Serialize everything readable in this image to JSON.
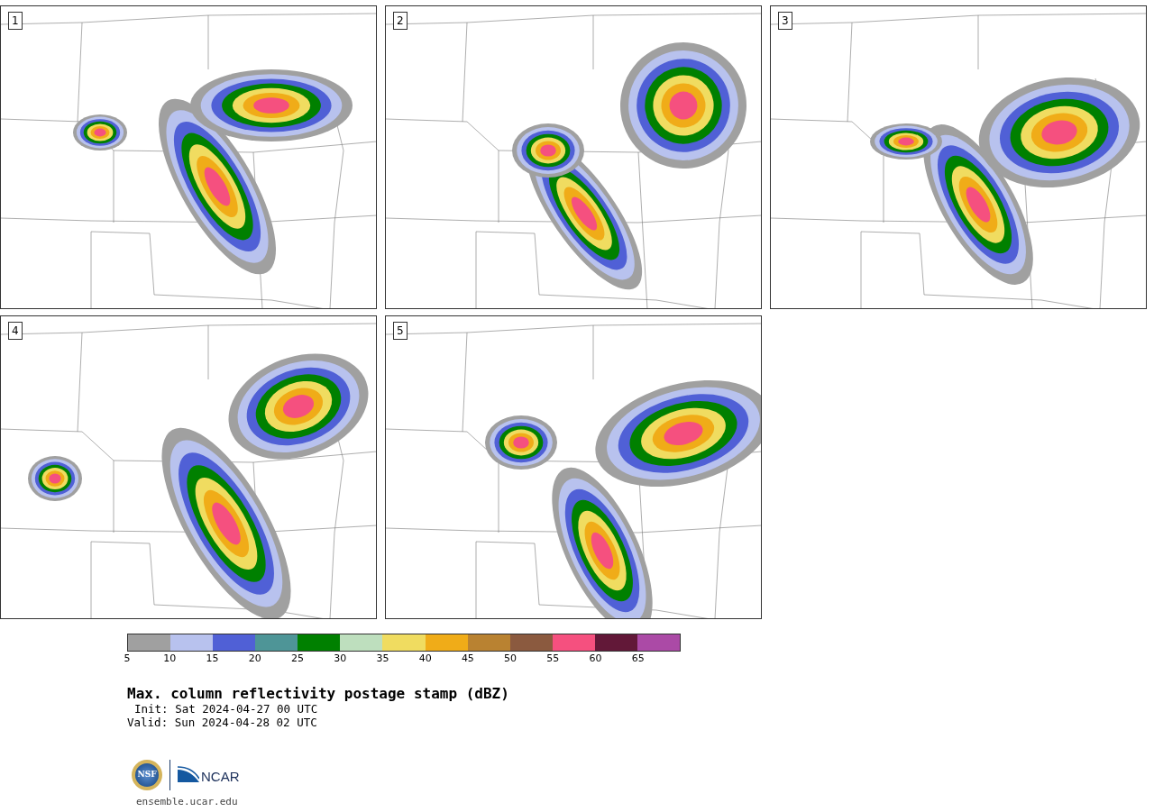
{
  "panels": [
    {
      "number": "1"
    },
    {
      "number": "2"
    },
    {
      "number": "3"
    },
    {
      "number": "4"
    },
    {
      "number": "5"
    }
  ],
  "colorbar": {
    "segments": [
      {
        "color": "#a0a0a0"
      },
      {
        "color": "#b8c2ee"
      },
      {
        "color": "#5060d6"
      },
      {
        "color": "#4e9597"
      },
      {
        "color": "#008000"
      },
      {
        "color": "#bedfbe"
      },
      {
        "color": "#f0dc60"
      },
      {
        "color": "#f0ac18"
      },
      {
        "color": "#b98231"
      },
      {
        "color": "#8b5a3f"
      },
      {
        "color": "#f5507f"
      },
      {
        "color": "#621838"
      },
      {
        "color": "#ab4aa6"
      }
    ],
    "ticks": [
      "5",
      "10",
      "15",
      "20",
      "25",
      "30",
      "35",
      "40",
      "45",
      "50",
      "55",
      "60",
      "65"
    ]
  },
  "title": "Max. column reflectivity postage stamp (dBZ)",
  "init": "Init: Sat 2024-04-27 00 UTC",
  "valid": "Valid: Sun 2024-04-28 02 UTC",
  "logos": {
    "left": "NSF",
    "right": "NCAR"
  },
  "url": "ensemble.ucar.edu"
}
